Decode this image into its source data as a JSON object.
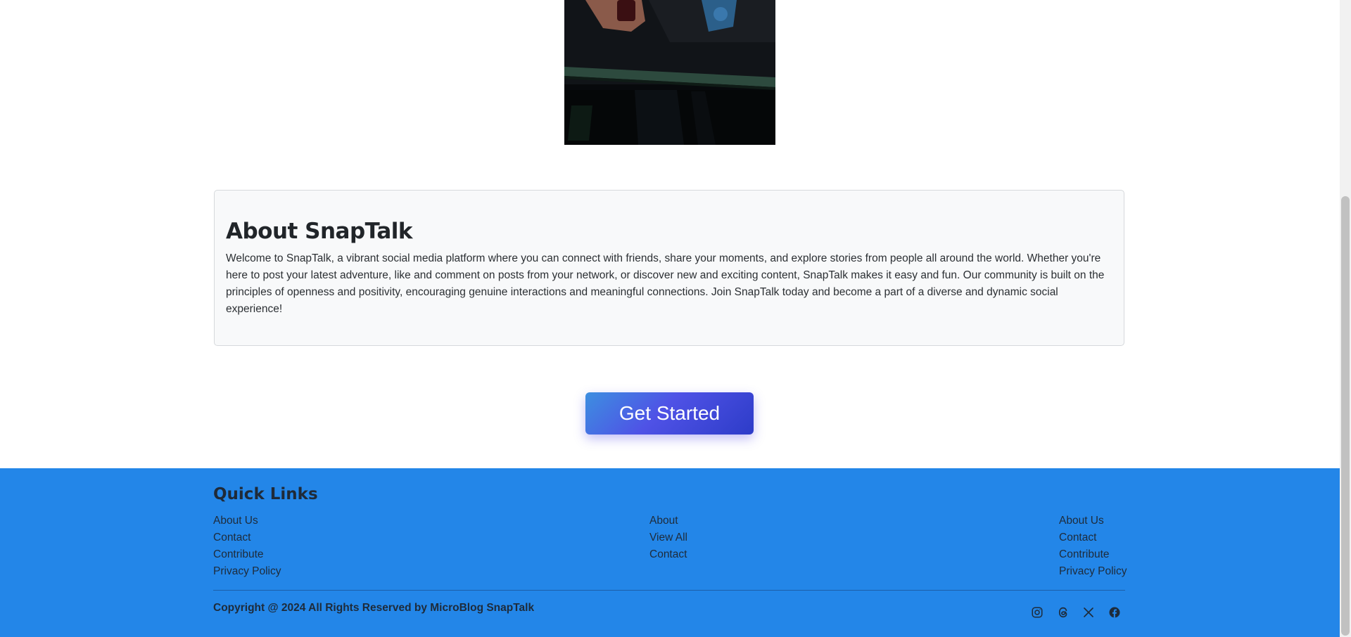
{
  "hero": {
    "image_alt": "person holding phone"
  },
  "about": {
    "title": "About SnapTalk",
    "text": "Welcome to SnapTalk, a vibrant social media platform where you can connect with friends, share your moments, and explore stories from people all around the world. Whether you're here to post your latest adventure, like and comment on posts from your network, or discover new and exciting content, SnapTalk makes it easy and fun. Our community is built on the principles of openness and positivity, encouraging genuine interactions and meaningful connections. Join SnapTalk today and become a part of a diverse and dynamic social experience!"
  },
  "cta": {
    "label": "Get Started"
  },
  "footer": {
    "heading": "Quick Links",
    "columns": [
      [
        "About Us",
        "Contact",
        "Contribute",
        "Privacy Policy"
      ],
      [
        "About",
        "View All",
        "Contact"
      ],
      [
        "About Us",
        "Contact",
        "Contribute",
        "Privacy Policy"
      ]
    ],
    "copyright": "Copyright @ 2024 All Rights Reserved by MicroBlog SnapTalk",
    "social": [
      "instagram-icon",
      "threads-icon",
      "x-icon",
      "facebook-icon"
    ]
  },
  "colors": {
    "footer_bg": "#2386e8",
    "cta_gradient_start": "#3d8fe0",
    "cta_gradient_end": "#2d3cc8",
    "card_bg": "#f8f9fa"
  }
}
